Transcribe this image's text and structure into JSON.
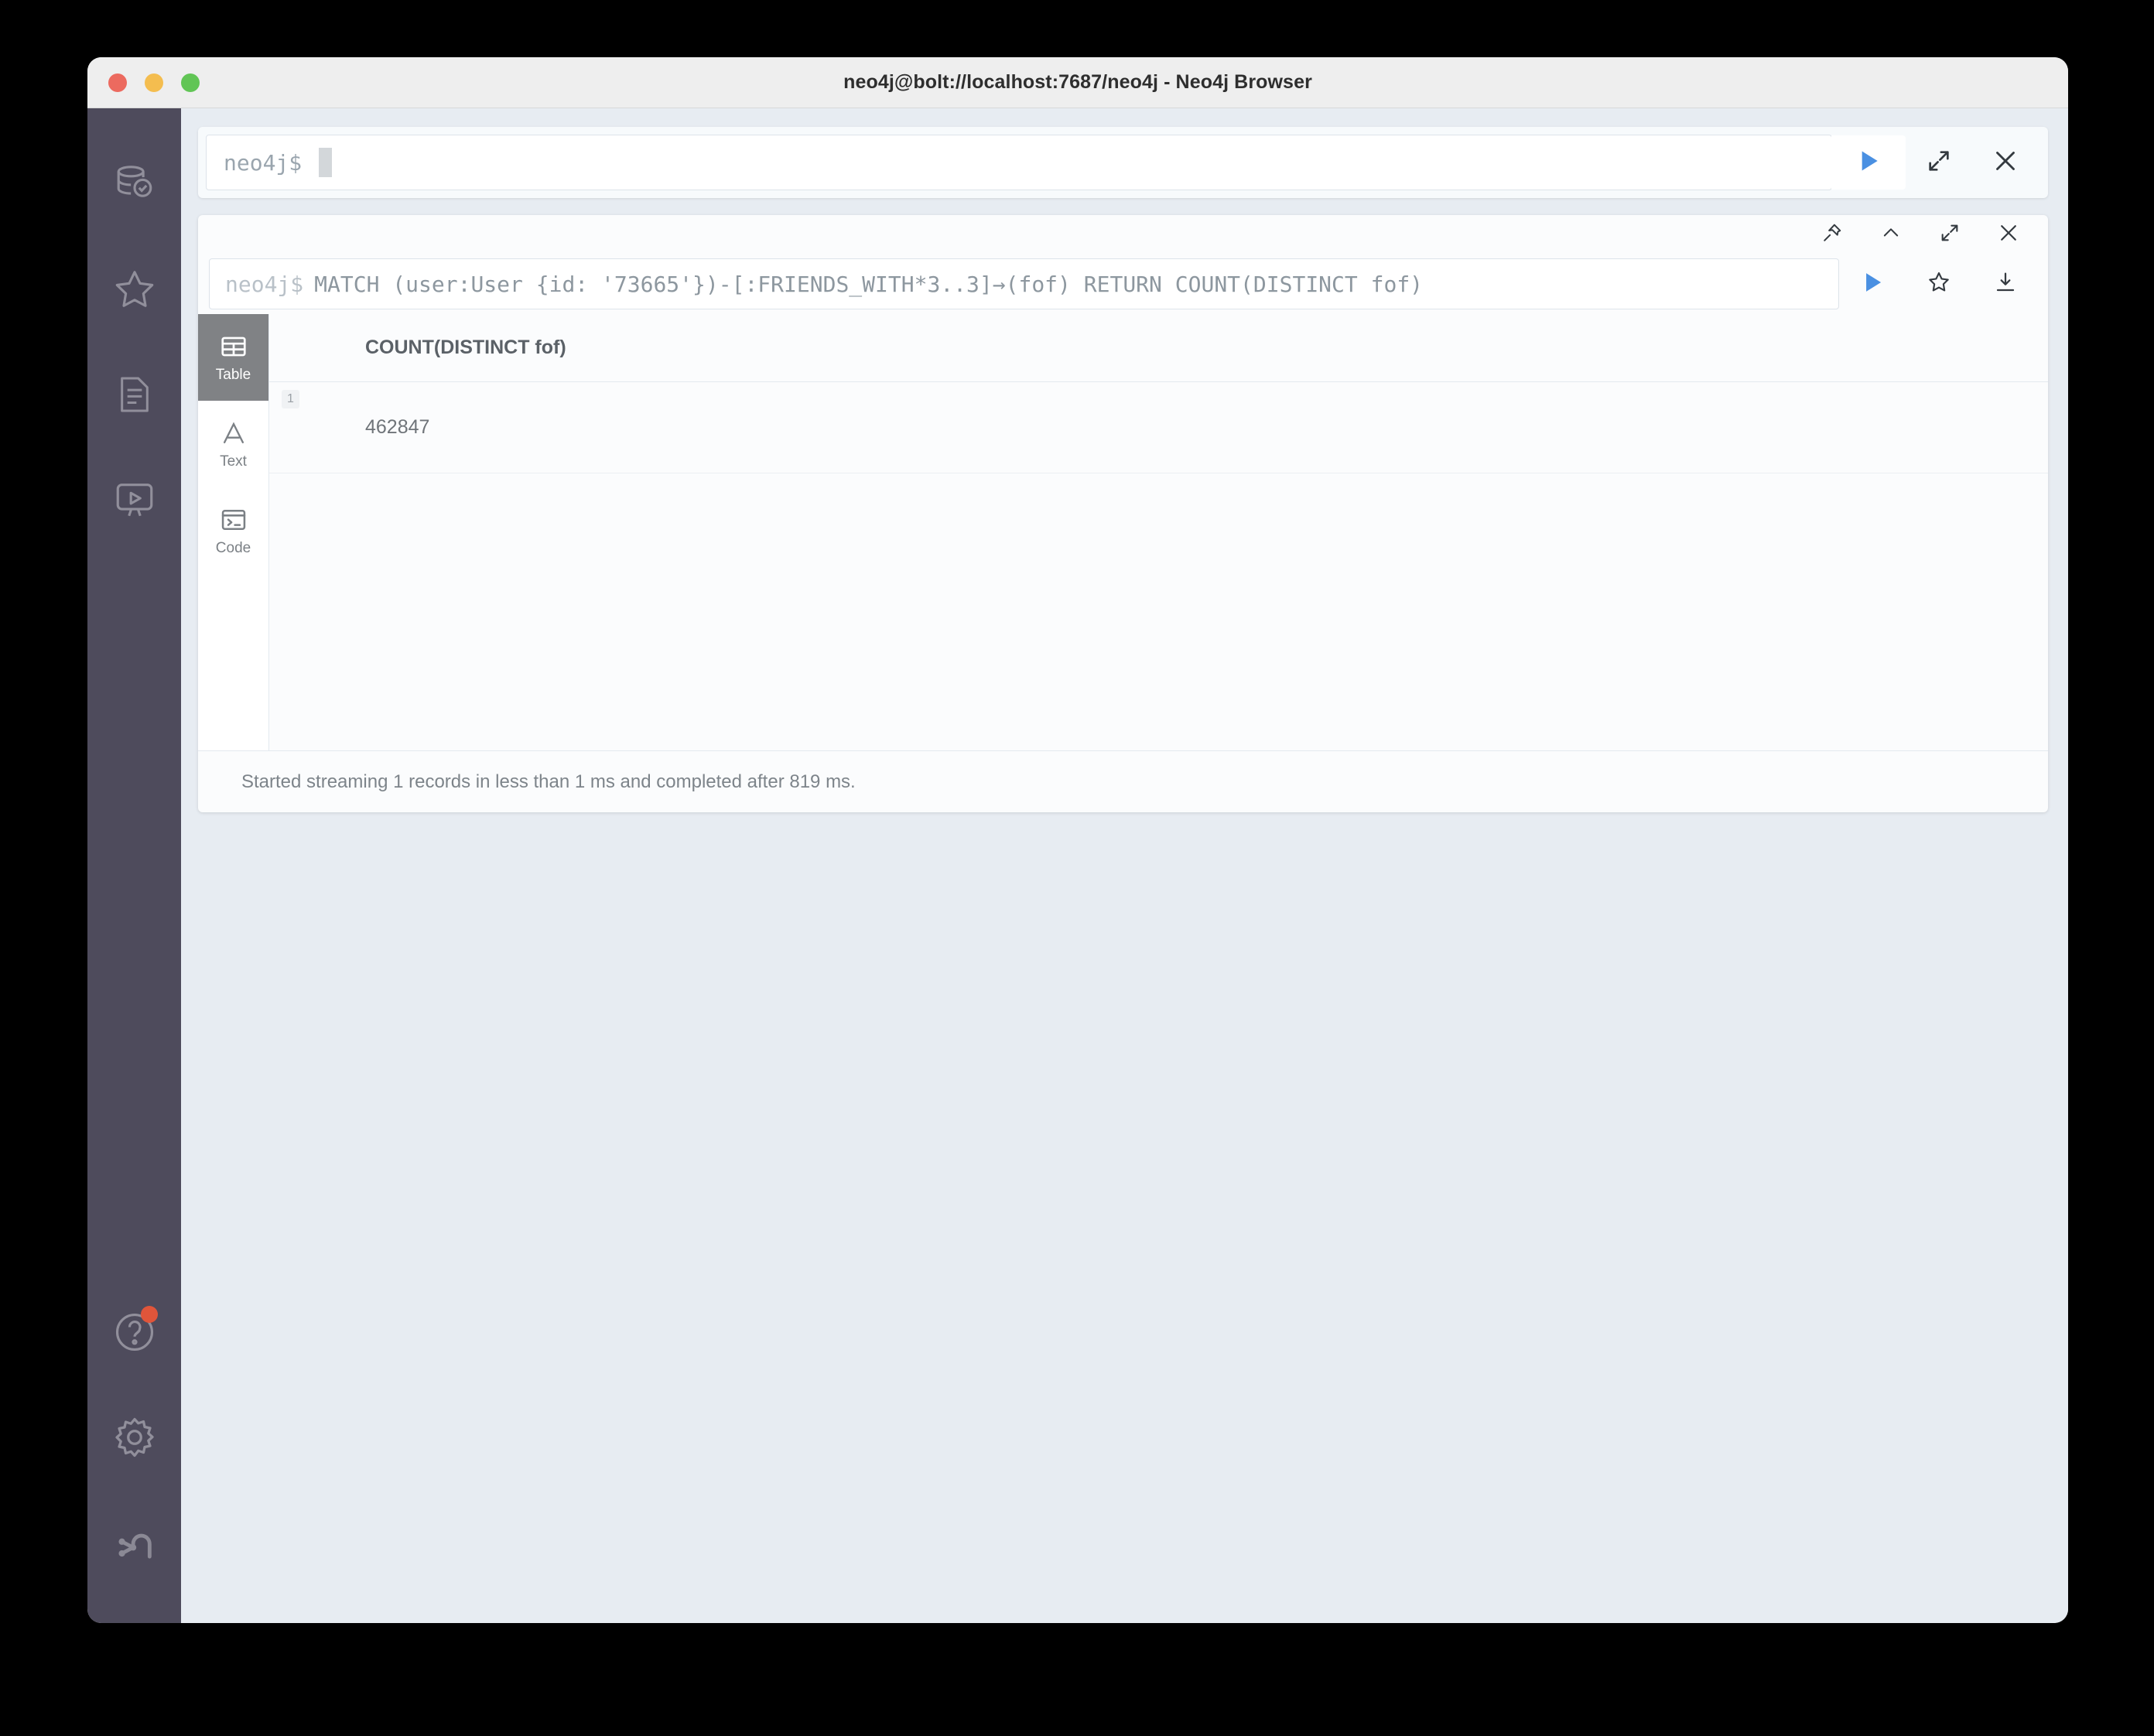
{
  "window": {
    "title": "neo4j@bolt://localhost:7687/neo4j - Neo4j Browser",
    "traffic_lights": [
      "close",
      "minimize",
      "zoom"
    ]
  },
  "sidebar": {
    "background": "#4e4b5c",
    "top_items": [
      {
        "name": "database-status",
        "icon": "database-check-icon"
      },
      {
        "name": "favorites",
        "icon": "star-icon"
      },
      {
        "name": "project-files",
        "icon": "document-icon"
      },
      {
        "name": "guides",
        "icon": "play-monitor-icon"
      }
    ],
    "bottom_items": [
      {
        "name": "help",
        "icon": "question-circle-icon",
        "has_notification": true,
        "notification_color": "#e0553a"
      },
      {
        "name": "settings",
        "icon": "gear-icon"
      },
      {
        "name": "about-neo4j",
        "icon": "neo4j-logo-icon"
      }
    ]
  },
  "editor": {
    "prompt": "neo4j$",
    "value": "",
    "placeholder": "",
    "accent": "#4a90e2",
    "actions": [
      {
        "name": "run-query-button",
        "icon": "play-icon"
      },
      {
        "name": "expand-editor-button",
        "icon": "expand-icon"
      },
      {
        "name": "close-editor-button",
        "icon": "close-icon"
      }
    ]
  },
  "frame": {
    "header_actions": [
      {
        "name": "pin-frame-button",
        "icon": "pin-icon"
      },
      {
        "name": "collapse-frame-button",
        "icon": "chevron-up-icon"
      },
      {
        "name": "expand-frame-button",
        "icon": "expand-icon"
      },
      {
        "name": "close-frame-button",
        "icon": "close-icon"
      }
    ],
    "query": {
      "prompt": "neo4j$",
      "text": "MATCH (user:User {id: '73665'})-[:FRIENDS_WITH*3..3]→(fof) RETURN COUNT(DISTINCT fof)"
    },
    "query_actions": [
      {
        "name": "rerun-query-button",
        "icon": "play-icon"
      },
      {
        "name": "favorite-query-button",
        "icon": "star-outline-icon"
      },
      {
        "name": "download-results-button",
        "icon": "download-icon"
      }
    ],
    "view_tabs": [
      {
        "name": "tab-table",
        "label": "Table",
        "icon": "table-icon",
        "active": true
      },
      {
        "name": "tab-text",
        "label": "Text",
        "icon": "letter-a-icon",
        "active": false
      },
      {
        "name": "tab-code",
        "label": "Code",
        "icon": "terminal-icon",
        "active": false
      }
    ],
    "table": {
      "columns": [
        "COUNT(DISTINCT fof)"
      ],
      "rows": [
        {
          "index": "1",
          "values": [
            "462847"
          ]
        }
      ]
    },
    "status": "Started streaming 1 records in less than 1 ms and completed after 819 ms."
  }
}
